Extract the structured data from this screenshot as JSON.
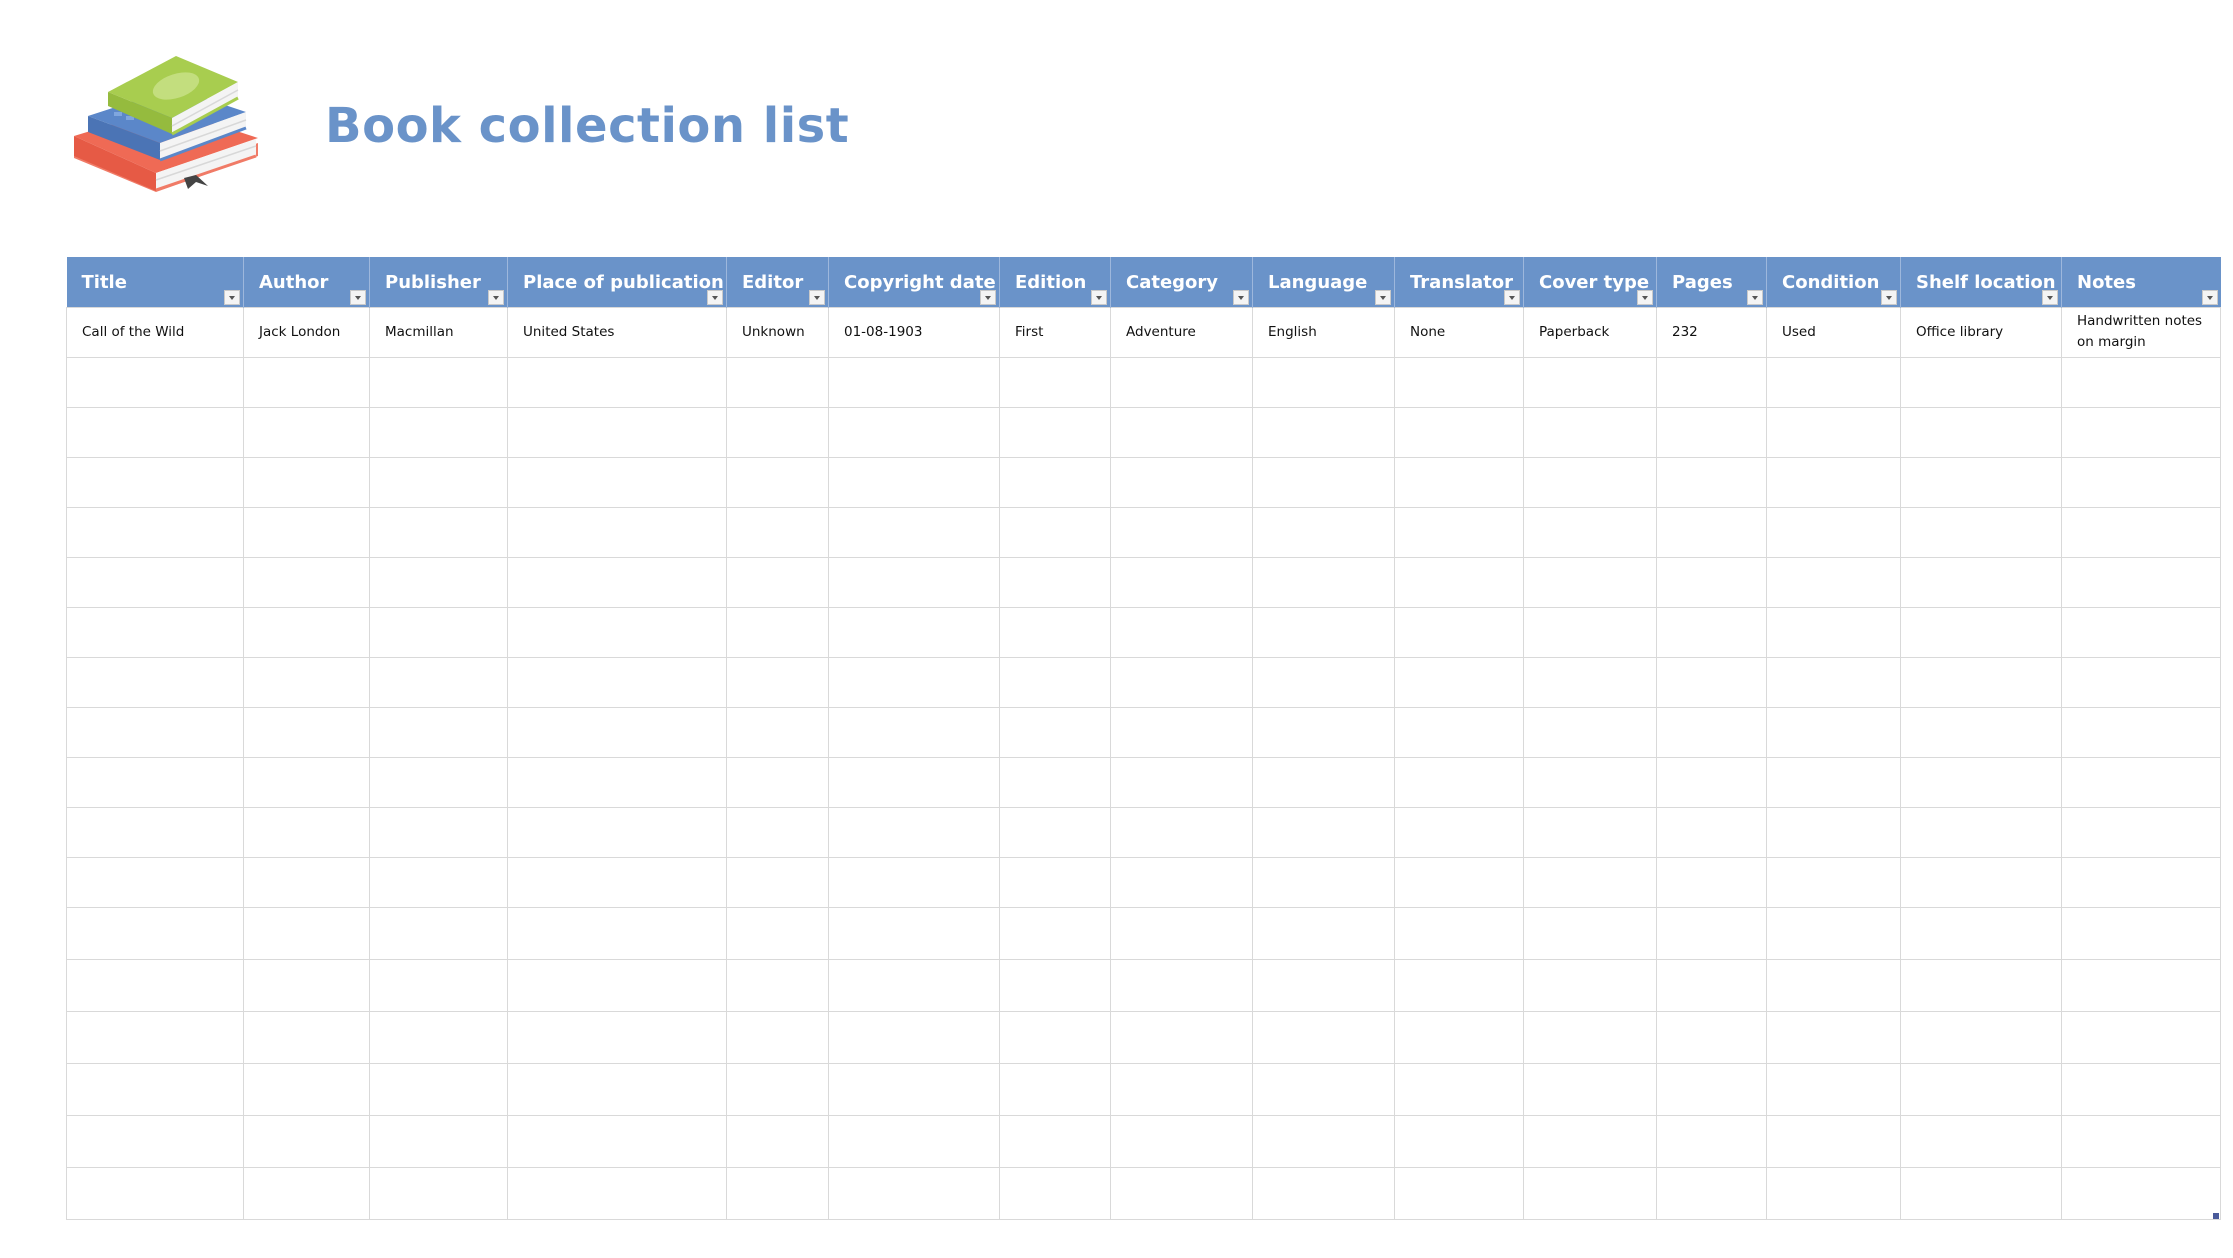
{
  "page": {
    "title": "Book collection list",
    "logo_icon": "book-stack-icon"
  },
  "colors": {
    "header_bg": "#6a93c9",
    "title": "#6a93c9",
    "grid": "#d9d9d9",
    "book_green": "#a8cd4f",
    "book_blue": "#5b87c9",
    "book_red": "#ef6a55"
  },
  "table": {
    "columns": [
      {
        "key": "title",
        "label": "Title"
      },
      {
        "key": "author",
        "label": "Author"
      },
      {
        "key": "publisher",
        "label": "Publisher"
      },
      {
        "key": "place",
        "label": "Place of publication"
      },
      {
        "key": "editor",
        "label": "Editor"
      },
      {
        "key": "copyright",
        "label": "Copyright date"
      },
      {
        "key": "edition",
        "label": "Edition"
      },
      {
        "key": "category",
        "label": "Category"
      },
      {
        "key": "language",
        "label": "Language"
      },
      {
        "key": "translator",
        "label": "Translator"
      },
      {
        "key": "cover",
        "label": "Cover type"
      },
      {
        "key": "pages",
        "label": "Pages"
      },
      {
        "key": "condition",
        "label": "Condition"
      },
      {
        "key": "shelf",
        "label": "Shelf location"
      },
      {
        "key": "notes",
        "label": "Notes"
      }
    ],
    "filter_icon": "filter-dropdown-icon",
    "rows": [
      [
        "Call of the Wild",
        "Jack London",
        "Macmillan",
        "United States",
        "Unknown",
        "01-08-1903",
        "First",
        "Adventure",
        "English",
        "None",
        "Paperback",
        "232",
        "Used",
        "Office library",
        "Handwritten notes on margin"
      ],
      [
        "",
        "",
        "",
        "",
        "",
        "",
        "",
        "",
        "",
        "",
        "",
        "",
        "",
        "",
        ""
      ],
      [
        "",
        "",
        "",
        "",
        "",
        "",
        "",
        "",
        "",
        "",
        "",
        "",
        "",
        "",
        ""
      ],
      [
        "",
        "",
        "",
        "",
        "",
        "",
        "",
        "",
        "",
        "",
        "",
        "",
        "",
        "",
        ""
      ],
      [
        "",
        "",
        "",
        "",
        "",
        "",
        "",
        "",
        "",
        "",
        "",
        "",
        "",
        "",
        ""
      ],
      [
        "",
        "",
        "",
        "",
        "",
        "",
        "",
        "",
        "",
        "",
        "",
        "",
        "",
        "",
        ""
      ],
      [
        "",
        "",
        "",
        "",
        "",
        "",
        "",
        "",
        "",
        "",
        "",
        "",
        "",
        "",
        ""
      ],
      [
        "",
        "",
        "",
        "",
        "",
        "",
        "",
        "",
        "",
        "",
        "",
        "",
        "",
        "",
        ""
      ],
      [
        "",
        "",
        "",
        "",
        "",
        "",
        "",
        "",
        "",
        "",
        "",
        "",
        "",
        "",
        ""
      ],
      [
        "",
        "",
        "",
        "",
        "",
        "",
        "",
        "",
        "",
        "",
        "",
        "",
        "",
        "",
        ""
      ],
      [
        "",
        "",
        "",
        "",
        "",
        "",
        "",
        "",
        "",
        "",
        "",
        "",
        "",
        "",
        ""
      ],
      [
        "",
        "",
        "",
        "",
        "",
        "",
        "",
        "",
        "",
        "",
        "",
        "",
        "",
        "",
        ""
      ],
      [
        "",
        "",
        "",
        "",
        "",
        "",
        "",
        "",
        "",
        "",
        "",
        "",
        "",
        "",
        ""
      ],
      [
        "",
        "",
        "",
        "",
        "",
        "",
        "",
        "",
        "",
        "",
        "",
        "",
        "",
        "",
        ""
      ],
      [
        "",
        "",
        "",
        "",
        "",
        "",
        "",
        "",
        "",
        "",
        "",
        "",
        "",
        "",
        ""
      ],
      [
        "",
        "",
        "",
        "",
        "",
        "",
        "",
        "",
        "",
        "",
        "",
        "",
        "",
        "",
        ""
      ],
      [
        "",
        "",
        "",
        "",
        "",
        "",
        "",
        "",
        "",
        "",
        "",
        "",
        "",
        "",
        ""
      ],
      [
        "",
        "",
        "",
        "",
        "",
        "",
        "",
        "",
        "",
        "",
        "",
        "",
        "",
        "",
        ""
      ]
    ]
  }
}
